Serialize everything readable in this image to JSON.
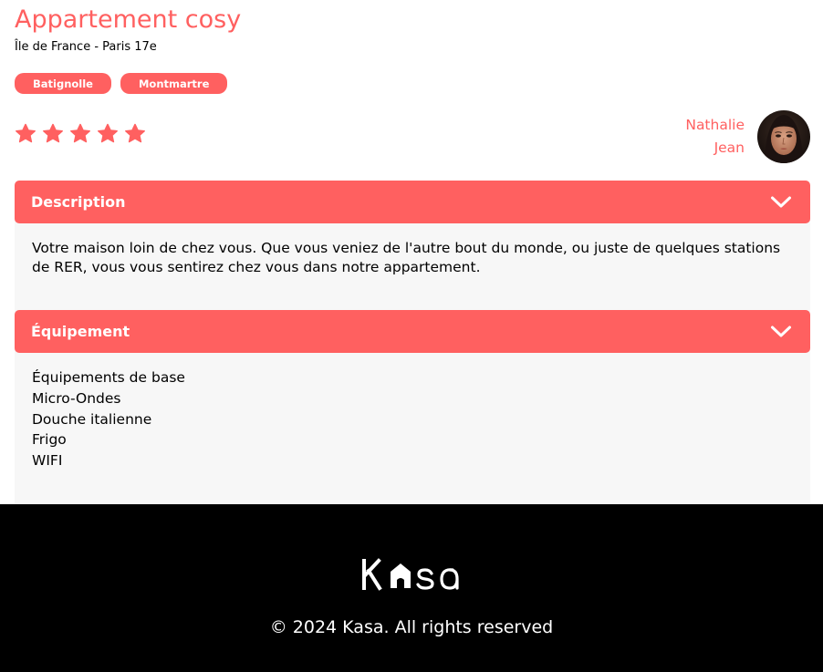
{
  "listing": {
    "title": "Appartement cosy",
    "location": "Île de France - Paris 17e",
    "tags": [
      "Batignolle",
      "Montmartre"
    ],
    "rating": 5,
    "rating_max": 5
  },
  "host": {
    "first_name": "Nathalie",
    "last_name": "Jean",
    "avatar_icon": "host-portrait"
  },
  "description": {
    "title": "Description",
    "text": "Votre maison loin de chez vous. Que vous veniez de l'autre bout du monde, ou juste de quelques stations de RER, vous vous sentirez chez vous dans notre appartement.",
    "toggle_icon": "chevron-down-icon"
  },
  "equipment": {
    "title": "Équipement",
    "items": [
      "Équipements de base",
      "Micro-Ondes",
      "Douche italienne",
      "Frigo",
      "WIFI"
    ],
    "toggle_icon": "chevron-down-icon"
  },
  "footer": {
    "logo_text": "Kasa",
    "copyright": "© 2024 Kasa. All rights reserved"
  },
  "colors": {
    "accent": "#ff6060",
    "body_bg": "#f7f7f7",
    "footer_bg": "#000000",
    "star_active": "#ff6060",
    "star_inactive": "#e3e3e3"
  }
}
